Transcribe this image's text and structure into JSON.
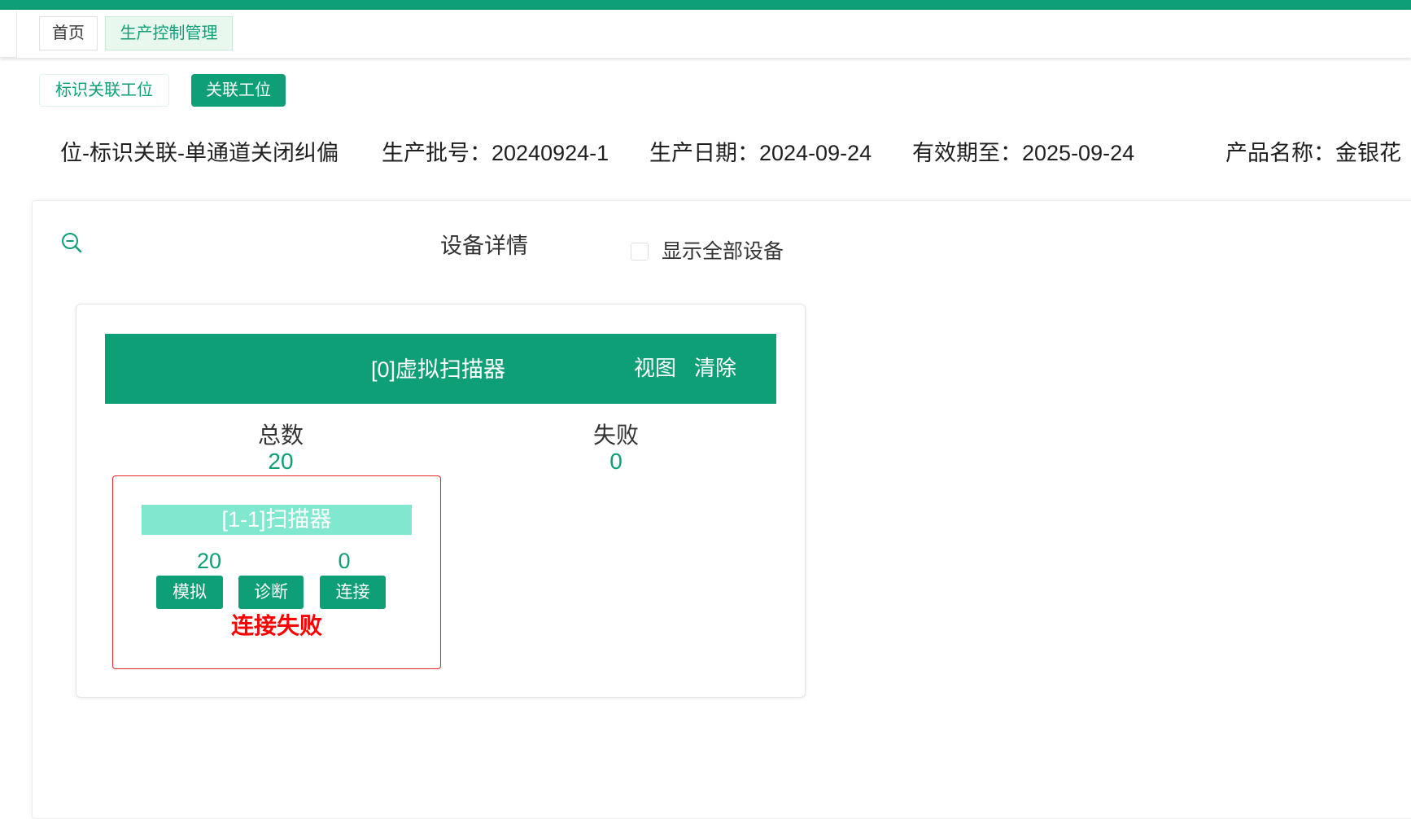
{
  "colors": {
    "primary": "#0e9f77",
    "scanner_title_bg": "#80e8cf",
    "error": "#ff0000",
    "active_tab_bg": "#e8f8ef"
  },
  "tabs": [
    {
      "label": "首页",
      "active": false
    },
    {
      "label": "生产控制管理",
      "active": true
    }
  ],
  "toolbar": {
    "mark_link_label": "标识关联工位",
    "link_label": "关联工位"
  },
  "info": {
    "station": "位-标识关联-单通道关闭纠偏",
    "batch": "生产批号：20240924-1",
    "date": "生产日期：2024-09-24",
    "expiry": "有效期至：2025-09-24",
    "product": "产品名称：金银花"
  },
  "panel": {
    "zoom_icon": "zoom-out-icon",
    "title": "设备详情",
    "show_all_label": "显示全部设备",
    "show_all_checked": false
  },
  "device": {
    "title": "[0]虚拟扫描器",
    "view_label": "视图",
    "clear_label": "清除",
    "total_label": "总数",
    "total_value": "20",
    "fail_label": "失败",
    "fail_value": "0",
    "scanner": {
      "title": "[1-1]扫描器",
      "total": "20",
      "fail": "0",
      "simulate_label": "模拟",
      "diagnose_label": "诊断",
      "connect_label": "连接",
      "status": "连接失败"
    }
  }
}
